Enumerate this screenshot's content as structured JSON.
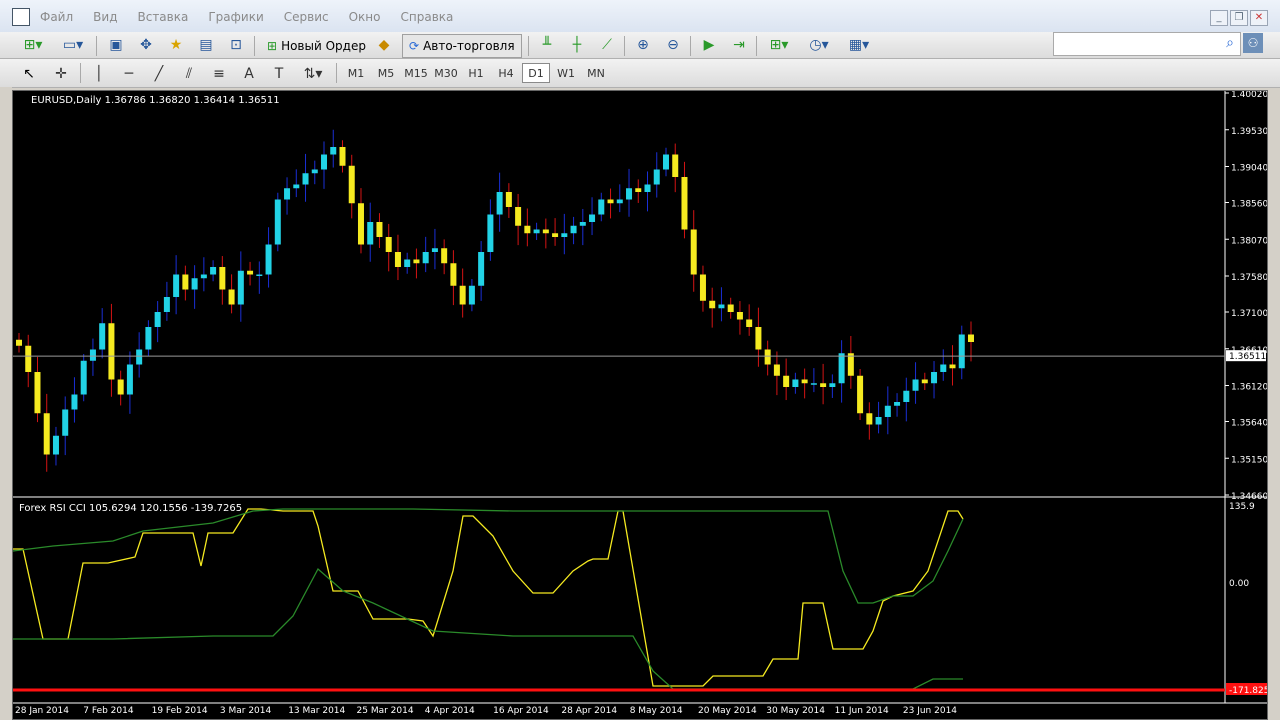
{
  "menu": [
    "Файл",
    "Вид",
    "Вставка",
    "Графики",
    "Сервис",
    "Окно",
    "Справка"
  ],
  "toolbar": {
    "new_order": "Новый Ордер",
    "autotrade": "Авто-торговля"
  },
  "timeframes": [
    "M1",
    "M5",
    "M15",
    "M30",
    "H1",
    "H4",
    "D1",
    "W1",
    "MN"
  ],
  "active_timeframe": "D1",
  "main_chart": {
    "header": "EURUSD,Daily  1.36786 1.36820 1.36414 1.36511",
    "price_axis": [
      "1.40020",
      "1.39530",
      "1.39040",
      "1.38560",
      "1.38070",
      "1.37580",
      "1.37100",
      "1.36610",
      "1.36120",
      "1.35640",
      "1.35150",
      "1.34660"
    ],
    "current_price": "1.36511",
    "colors": {
      "bull": "#22d3e6",
      "bear": "#f5ea20",
      "bull_wick": "#1a2fd6",
      "bear_wick": "#d41414",
      "bg": "#000000"
    }
  },
  "indicator": {
    "header": "Forex RSI CCI 105.6294 120.1556 -139.7265",
    "axis": [
      "135.9",
      "0.00",
      "-171.8252"
    ],
    "colors": {
      "line": "#f5ea20",
      "bands": "#2a8a2a",
      "level": "#ff1010"
    }
  },
  "date_axis": [
    "28 Jan 2014",
    "7 Feb 2014",
    "19 Feb 2014",
    "3 Mar 2014",
    "13 Mar 2014",
    "25 Mar 2014",
    "4 Apr 2014",
    "16 Apr 2014",
    "28 Apr 2014",
    "8 May 2014",
    "20 May 2014",
    "30 May 2014",
    "11 Jun 2014",
    "23 Jun 2014"
  ],
  "chart_data": {
    "type": "candlestick",
    "ylim": [
      1.3466,
      1.4002
    ],
    "closes": [
      1.3665,
      1.363,
      1.3575,
      1.352,
      1.3545,
      1.358,
      1.36,
      1.3645,
      1.366,
      1.3695,
      1.362,
      1.36,
      1.364,
      1.366,
      1.369,
      1.371,
      1.373,
      1.376,
      1.374,
      1.3755,
      1.376,
      1.377,
      1.374,
      1.372,
      1.3765,
      1.376,
      1.376,
      1.38,
      1.386,
      1.3875,
      1.388,
      1.3895,
      1.39,
      1.392,
      1.393,
      1.3905,
      1.3855,
      1.38,
      1.383,
      1.381,
      1.379,
      1.377,
      1.378,
      1.3775,
      1.379,
      1.3795,
      1.3775,
      1.3745,
      1.372,
      1.3745,
      1.379,
      1.384,
      1.387,
      1.385,
      1.3825,
      1.3815,
      1.382,
      1.3815,
      1.381,
      1.3815,
      1.3825,
      1.383,
      1.384,
      1.386,
      1.3855,
      1.386,
      1.3875,
      1.387,
      1.388,
      1.39,
      1.392,
      1.389,
      1.382,
      1.376,
      1.3725,
      1.3715,
      1.372,
      1.371,
      1.37,
      1.369,
      1.366,
      1.364,
      1.3625,
      1.361,
      1.362,
      1.3615,
      1.3615,
      1.361,
      1.3615,
      1.3655,
      1.3625,
      1.3575,
      1.356,
      1.357,
      1.3585,
      1.359,
      1.3605,
      1.362,
      1.3615,
      1.363,
      1.364,
      1.3635,
      1.368,
      1.367
    ]
  }
}
